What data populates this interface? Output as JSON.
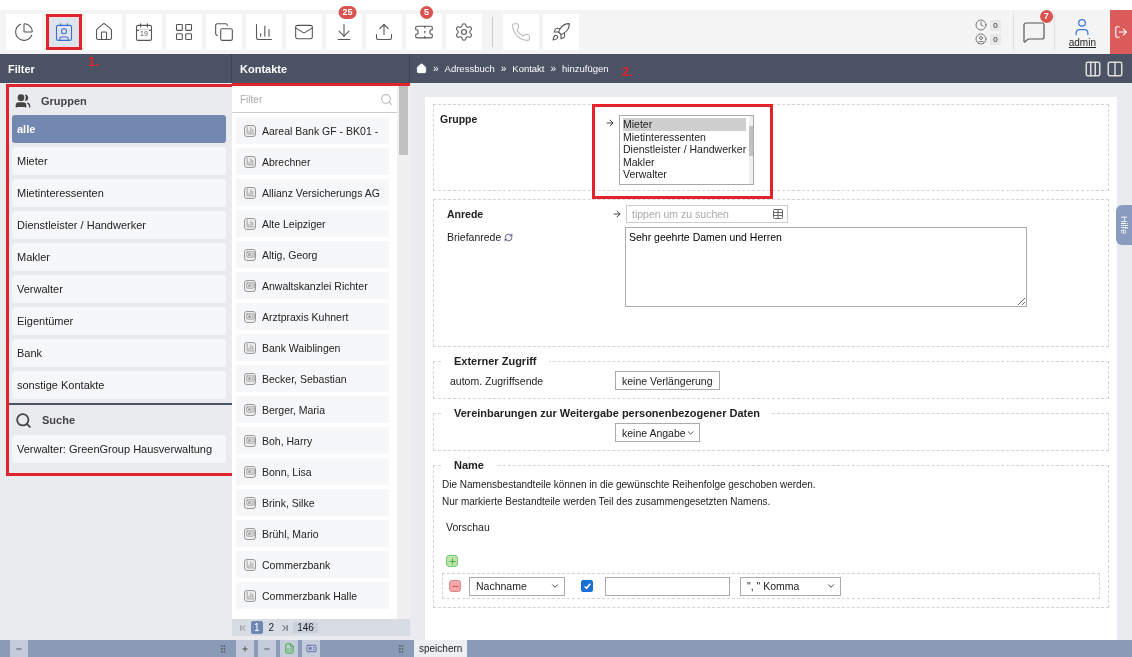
{
  "toolbar": {
    "items": [
      {
        "kind": "dashboard",
        "selected": false
      },
      {
        "kind": "contacts",
        "selected": true,
        "framed": true
      },
      {
        "kind": "home",
        "selected": false
      },
      {
        "kind": "calendar",
        "selected": false,
        "text": "19"
      },
      {
        "kind": "layout",
        "selected": false
      },
      {
        "kind": "documents",
        "selected": false
      },
      {
        "kind": "chart",
        "selected": false
      },
      {
        "kind": "mail",
        "selected": false
      },
      {
        "kind": "inbox",
        "selected": false,
        "badge": "25"
      },
      {
        "kind": "upload",
        "selected": false
      },
      {
        "kind": "ticket",
        "selected": false,
        "badge": "5"
      },
      {
        "kind": "settings",
        "selected": false
      },
      {
        "kind": "phone",
        "selected": false,
        "disabled": true
      },
      {
        "kind": "rocket",
        "selected": false
      }
    ],
    "counters": [
      {
        "kind": "clock",
        "value": "0"
      },
      {
        "kind": "person",
        "value": "0"
      }
    ],
    "messages_badge": "7",
    "user": "admin"
  },
  "header": {
    "filter_title": "Filter",
    "contacts_title": "Kontakte",
    "separator": "»",
    "breadcrumb": [
      "Adressbuch",
      "Kontakt",
      "hinzufügen"
    ]
  },
  "annotations": [
    "1.",
    "2."
  ],
  "filter": {
    "groups_title": "Gruppen",
    "groups": [
      {
        "label": "alle",
        "selected": true
      },
      {
        "label": "Mieter",
        "selected": false
      },
      {
        "label": "Mietinteressenten",
        "selected": false
      },
      {
        "label": "Dienstleister / Handwerker",
        "selected": false
      },
      {
        "label": "Makler",
        "selected": false
      },
      {
        "label": "Verwalter",
        "selected": false
      },
      {
        "label": "Eigentümer",
        "selected": false
      },
      {
        "label": "Bank",
        "selected": false
      },
      {
        "label": "sonstige Kontakte",
        "selected": false
      }
    ],
    "search_title": "Suche",
    "searches": [
      "Verwalter: GreenGroup Hausverwaltung"
    ]
  },
  "contacts": {
    "filter_placeholder": "Filter",
    "items": [
      {
        "name": "Aareal Bank GF - BK01 -",
        "kind": "company"
      },
      {
        "name": "Abrechner",
        "kind": "company"
      },
      {
        "name": "Allianz Versicherungs AG",
        "kind": "company"
      },
      {
        "name": "Alte Leipziger",
        "kind": "company"
      },
      {
        "name": "Altig, Georg",
        "kind": "person"
      },
      {
        "name": "Anwaltskanzlei Richter",
        "kind": "person"
      },
      {
        "name": "Arztpraxis Kuhnert",
        "kind": "person"
      },
      {
        "name": "Bank Waiblingen",
        "kind": "company"
      },
      {
        "name": "Becker, Sebastian",
        "kind": "person"
      },
      {
        "name": "Berger, Maria",
        "kind": "person"
      },
      {
        "name": "Boh, Harry",
        "kind": "person"
      },
      {
        "name": "Bonn, Lisa",
        "kind": "person"
      },
      {
        "name": "Brink, Silke",
        "kind": "person"
      },
      {
        "name": "Brühl, Mario",
        "kind": "person"
      },
      {
        "name": "Commerzbank",
        "kind": "company"
      },
      {
        "name": "Commerzbank Halle",
        "kind": "company"
      }
    ],
    "pages": [
      {
        "label": "1",
        "selected": true
      },
      {
        "label": "2",
        "selected": false
      }
    ],
    "total": "146"
  },
  "form": {
    "group": {
      "label": "Gruppe",
      "options": [
        {
          "label": "Mieter",
          "selected": true
        },
        {
          "label": "Mietinteressenten",
          "selected": false
        },
        {
          "label": "Dienstleister / Handwerker",
          "selected": false
        },
        {
          "label": "Makler",
          "selected": false
        },
        {
          "label": "Verwalter",
          "selected": false
        }
      ]
    },
    "salutation": {
      "label": "Anrede",
      "placeholder": "tippen um zu suchen",
      "letter_label": "Briefanrede",
      "letter_value": "Sehr geehrte Damen und Herren"
    },
    "external": {
      "legend": "Externer Zugriff",
      "label": "autom. Zugriffsende",
      "value": "keine Verlängerung"
    },
    "agreements": {
      "legend": "Vereinbarungen zur Weitergabe personenbezogener Daten",
      "value": "keine Angabe"
    },
    "name": {
      "legend": "Name",
      "notes": [
        "Die Namensbestandteile können in die gewünschte Reihenfolge geschoben werden.",
        "Nur markierte Bestandteile werden Teil des zusammengesetzten Namens."
      ],
      "preview_label": "Vorschau",
      "parts": [
        {
          "part": "Nachname",
          "checked": true,
          "separator": "\", \" Komma"
        }
      ]
    }
  },
  "help_tab": "Hilfe",
  "bottom": {
    "save": "speichern"
  }
}
